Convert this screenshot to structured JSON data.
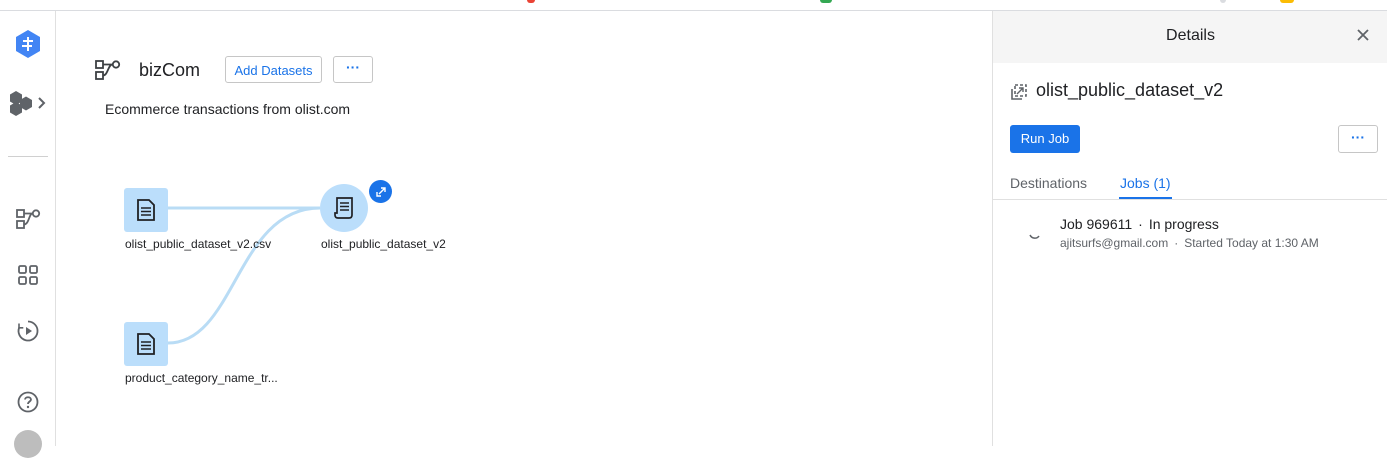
{
  "flow": {
    "title": "bizCom",
    "add_datasets_label": "Add Datasets",
    "more_label": "···",
    "description": "Ecommerce transactions from olist.com"
  },
  "nodes": {
    "source1_label": "olist_public_dataset_v2.csv",
    "source2_label": "product_category_name_tr...",
    "recipe_label": "olist_public_dataset_v2"
  },
  "details": {
    "title": "Details",
    "dataset_name": "olist_public_dataset_v2",
    "run_job_label": "Run Job",
    "more_label": "···",
    "tabs": [
      {
        "label": "Destinations"
      },
      {
        "label": "Jobs (1)"
      }
    ],
    "job": {
      "title": "Job 969611",
      "status": "In progress",
      "user": "ajitsurfs@gmail.com",
      "started": "Started Today at 1:30 AM"
    }
  },
  "colors": {
    "accent": "#1a73e8",
    "node_fill": "#bbdefb",
    "edge": "#b9dcf5"
  }
}
